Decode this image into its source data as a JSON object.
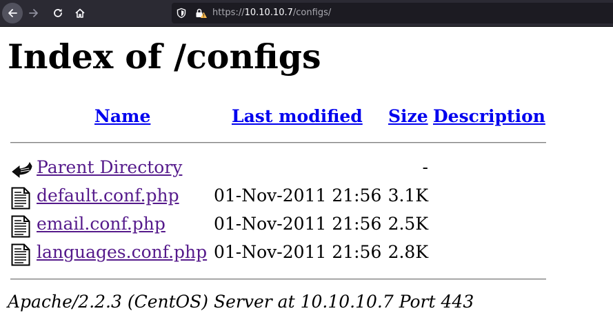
{
  "browser": {
    "url_scheme": "https://",
    "url_host": "10.10.10.7",
    "url_path": "/configs/"
  },
  "page": {
    "title": "Index of /configs",
    "columns": {
      "name": "Name",
      "last_modified": "Last modified",
      "size": "Size",
      "description": "Description"
    },
    "entries": [
      {
        "name": "Parent Directory",
        "modified": "",
        "size": "-",
        "icon": "back-arrow-icon"
      },
      {
        "name": "default.conf.php",
        "modified": "01-Nov-2011 21:56",
        "size": "3.1K",
        "icon": "text-file-icon"
      },
      {
        "name": "email.conf.php",
        "modified": "01-Nov-2011 21:56",
        "size": "2.5K",
        "icon": "text-file-icon"
      },
      {
        "name": "languages.conf.php",
        "modified": "01-Nov-2011 21:56",
        "size": "2.8K",
        "icon": "text-file-icon"
      }
    ],
    "footer": "Apache/2.2.3 (CentOS) Server at 10.10.10.7 Port 443"
  },
  "colors": {
    "toolbar_bg": "#2b2a33",
    "urlbar_bg": "#1c1b22",
    "link": "#0000ee",
    "visited_link": "#551a8b",
    "warning_yellow": "#ffbd4f"
  }
}
